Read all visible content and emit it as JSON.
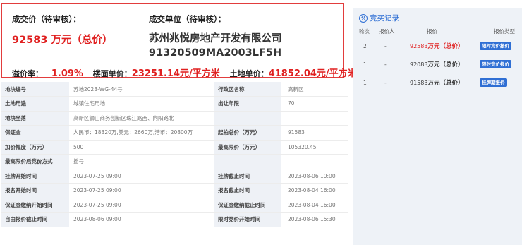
{
  "summary": {
    "price_label": "成交价（待审核）：",
    "price_value": "92583 万元（总价）",
    "company_label": "成交单位（待审核）：",
    "company_name": "苏州兆悦房地产开发有限公司",
    "company_code": "91320509MA2003LF5H",
    "premium_label": "溢价率：",
    "premium_value": "1.09%",
    "floor_price_label": "楼面单价：",
    "floor_price_value": "23251.14元/平方米",
    "land_price_label": "土地单价：",
    "land_price_value": "41852.04元/平方米"
  },
  "details": [
    {
      "label1": "地块编号",
      "value1": "苏地2023-WG-44号",
      "label2": "行政区名称",
      "value2": "高新区"
    },
    {
      "label1": "土地用途",
      "value1": "城镇住宅用地",
      "label2": "出让年限",
      "value2": "70"
    },
    {
      "label1": "地块坐落",
      "value1": "高新区狮山商务创新区珠江路西、向阳路北",
      "label2": "",
      "value2": ""
    },
    {
      "label1": "保证金",
      "value1": "人民币：18320万,美元：2660万,港币：20800万",
      "label2": "起拍总价（万元）",
      "value2": "91583"
    },
    {
      "label1": "加价幅度（万元）",
      "value1": "500",
      "label2": "最高限价（万元）",
      "value2": "105320.45"
    },
    {
      "label1": "最高限价后竞价方式",
      "value1": "摇号",
      "label2": "",
      "value2": ""
    },
    {
      "label1": "挂牌开始时间",
      "value1": "2023-07-25 09:00",
      "label2": "挂牌截止时间",
      "value2": "2023-08-06 10:00"
    },
    {
      "label1": "报名开始时间",
      "value1": "2023-07-25 09:00",
      "label2": "报名截止时间",
      "value2": "2023-08-04 16:00"
    },
    {
      "label1": "保证金缴纳开始时间",
      "value1": "2023-07-25 09:00",
      "label2": "保证金缴纳截止时间",
      "value2": "2023-08-04 16:00"
    },
    {
      "label1": "自由报价截止时间",
      "value1": "2023-08-06 09:00",
      "label2": "限时竞价开始时间",
      "value2": "2023-08-06 15:30"
    }
  ],
  "bid_panel": {
    "title": "竞买记录",
    "icon": "hammer-icon",
    "headers": [
      "轮次",
      "报价人",
      "报价",
      "报价类型"
    ],
    "rows": [
      {
        "round": "2",
        "bidder": "-",
        "amount": "92583",
        "unit": "万元（总价）",
        "type": "限时竞价报价"
      },
      {
        "round": "1",
        "bidder": "-",
        "amount": "92083",
        "unit": "万元（总价）",
        "type": "限时竞价报价"
      },
      {
        "round": "1",
        "bidder": "-",
        "amount": "91583",
        "unit": "万元（总价）",
        "type": "挂牌期报价"
      }
    ]
  },
  "colors": {
    "accent_red": "#e02020",
    "accent_blue": "#2f6fd4",
    "panel_bg": "#eef2f7",
    "label_bg": "#eef1f6"
  }
}
